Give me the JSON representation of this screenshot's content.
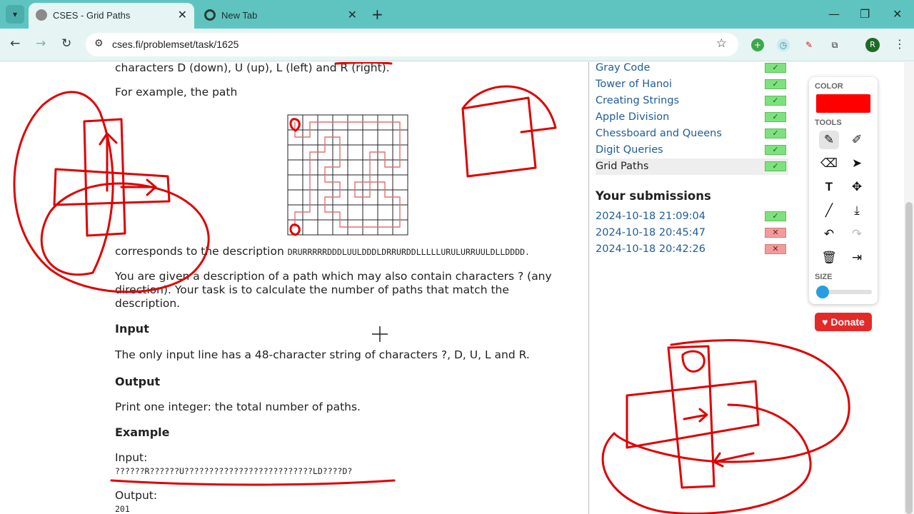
{
  "browser": {
    "tabs": [
      {
        "label": "CSES - Grid Paths",
        "active": true
      },
      {
        "label": "New Tab",
        "active": false
      }
    ],
    "url": "cses.fi/problemset/task/1625",
    "avatar_letter": "R"
  },
  "problem": {
    "line_top": "characters D (down), U (up), L (left) and R (right).",
    "example_intro": "For example, the path",
    "corresponds_prefix": "corresponds to the description",
    "description_code": "DRURRRRRDDDLUULDDDLDRRURDDLLLLLURULURRUULDLLDDDD.",
    "para_line1": "You are given a description of a path which may also contain characters ? (any",
    "para_line2": "direction). Your task is to calculate the number of paths that match the",
    "para_line3": "description.",
    "input_heading": "Input",
    "input_text": "The only input line has a 48-character string of characters ?, D, U, L and R.",
    "output_heading": "Output",
    "output_text": "Print one integer: the total number of paths.",
    "example_heading": "Example",
    "example_input_label": "Input:",
    "example_input_value": "??????R??????U??????????????????????????LD????D?",
    "example_output_label": "Output:",
    "example_output_value": "201"
  },
  "sidebar": {
    "tasks": [
      {
        "label": "Gray Code",
        "status": "accepted"
      },
      {
        "label": "Tower of Hanoi",
        "status": "accepted"
      },
      {
        "label": "Creating Strings",
        "status": "accepted"
      },
      {
        "label": "Apple Division",
        "status": "accepted"
      },
      {
        "label": "Chessboard and Queens",
        "status": "accepted"
      },
      {
        "label": "Digit Queries",
        "status": "accepted"
      },
      {
        "label": "Grid Paths",
        "status": "accepted"
      }
    ],
    "submissions_title": "Your submissions",
    "submissions": [
      {
        "time": "2024-10-18 21:09:04",
        "status": "accepted"
      },
      {
        "time": "2024-10-18 20:45:47",
        "status": "rejected"
      },
      {
        "time": "2024-10-18 20:42:26",
        "status": "rejected"
      }
    ]
  },
  "draw_panel": {
    "color_label": "COLOR",
    "tools_label": "TOOLS",
    "size_label": "SIZE",
    "color_value": "#ff0000"
  },
  "donate_label": "Donate",
  "colors": {
    "accent": "#5fc4c0",
    "ink": "#e00000"
  }
}
